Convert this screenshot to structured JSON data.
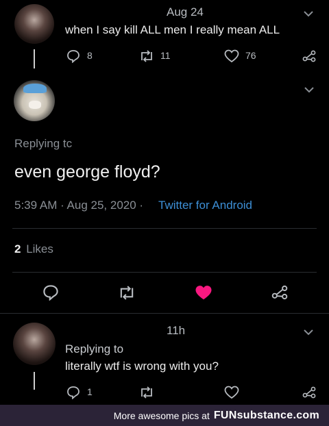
{
  "tweet1": {
    "time": "Aug 24",
    "text": "when I say kill ALL men I really mean ALL",
    "replies": "8",
    "retweets": "11",
    "likes": "76"
  },
  "main_tweet": {
    "replying_to": "Replying tc",
    "text": "even george floyd?",
    "datetime": "5:39 AM · Aug 25, 2020 ·",
    "source": "Twitter for Android",
    "likes_count": "2",
    "likes_label": "Likes",
    "liked_color": "#f91880"
  },
  "reply": {
    "time": "11h",
    "replying_to": "Replying to",
    "text": "literally wtf is wrong with you?",
    "replies": "1"
  },
  "footer": {
    "text": "More awesome pics at",
    "brand": "FUNsubstance.com"
  }
}
